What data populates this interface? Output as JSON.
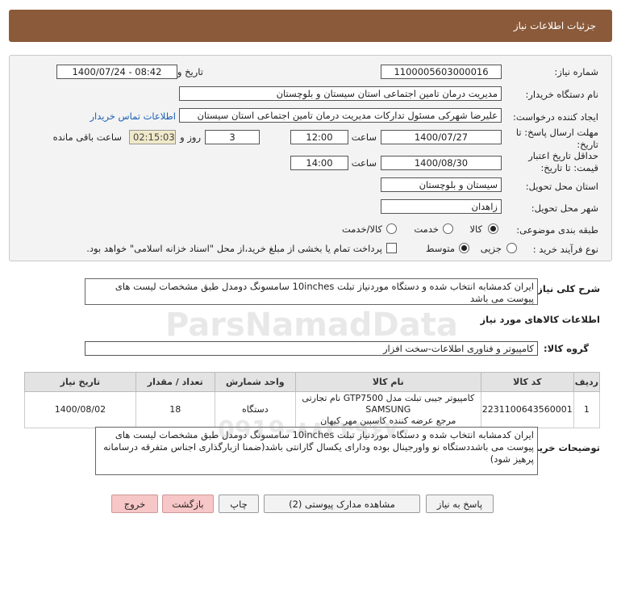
{
  "header": {
    "title": "جزئیات اطلاعات نیاز"
  },
  "form": {
    "need_number_label": "شماره نیاز:",
    "need_number": "1100005603000016",
    "announce_label": "تاریخ و ساعت اعلان عمومی:",
    "announce_value": "1400/07/24 - 08:42",
    "buyer_label": "نام دستگاه خریدار:",
    "buyer_value": "مدیریت درمان تامین اجتماعی استان سیستان و بلوچستان",
    "creator_label": "ایجاد کننده درخواست:",
    "creator_value": "علیرضا شهرکی مسئول تدارکات مدیریت درمان تامین اجتماعی استان سیستان",
    "contact_link": "اطلاعات تماس خریدار",
    "reply_deadline_label": "مهلت ارسال پاسخ: تا تاریخ:",
    "reply_date": "1400/07/27",
    "time_label": "ساعت",
    "reply_time": "12:00",
    "days_value": "3",
    "days_label": "روز و",
    "remaining_value": "02:15:03",
    "remaining_label": "ساعت باقی مانده",
    "validity_label": "حداقل تاریخ اعتبار قیمت: تا تاریخ:",
    "validity_date": "1400/08/30",
    "validity_time": "14:00",
    "province_label": "استان محل تحویل:",
    "province_value": "سیستان و بلوچستان",
    "city_label": "شهر محل تحویل:",
    "city_value": "زاهدان",
    "category_label": "طبقه بندی موضوعی:",
    "category_options": [
      "کالا",
      "خدمت",
      "کالا/خدمت"
    ],
    "category_selected": "کالا",
    "process_label": "نوع فرآیند خرید :",
    "process_options": [
      "جزیی",
      "متوسط"
    ],
    "process_selected": "متوسط",
    "payment_note": "پرداخت تمام یا بخشی از مبلغ خرید،از محل \"اسناد خزانه اسلامی\" خواهد بود."
  },
  "summary": {
    "label": "شرح کلی نیاز:",
    "text": "ایران کدمشابه انتخاب شده و دستگاه موردنیاز تبلت 10inches سامسونگ دومدل طبق مشخصات لیست های پیوست می باشد"
  },
  "goods": {
    "section_title": "اطلاعات کالاهای مورد نیاز",
    "group_label": "گروه کالا:",
    "group_value": "کامپیوتر و فناوری اطلاعات-سخت افزار",
    "columns": [
      "ردیف",
      "کد کالا",
      "نام کالا",
      "واحد شمارش",
      "تعداد / مقدار",
      "تاریخ نیاز"
    ],
    "rows": [
      {
        "index": "1",
        "code": "2231100643560001",
        "name_line1": "کامپیوتر جیبی تبلت مدل GTP7500 نام تجارتی SAMSUNG",
        "name_line2": "مرجع عرضه کننده کاسپین مهر کیهان",
        "unit": "دستگاه",
        "qty": "18",
        "date": "1400/08/02"
      }
    ]
  },
  "notes": {
    "label": "توضیحات خریدار:",
    "text": "ایران کدمشابه انتخاب شده و دستگاه موردنیاز تبلت 10inches سامسونگ دومدل طبق مشخصات لیست های پیوست می باشددستگاه نو واورجینال بوده ودارای یکسال گارانتی باشد(ضمنا ازبارگذاری اجناس متفرقه درسامانه پرهیز شود)"
  },
  "buttons": {
    "reply": "پاسخ به نیاز",
    "attachments": "مشاهده مدارک پیوستی (2)",
    "print": "چاپ",
    "back": "بازگشت",
    "exit": "خروج"
  },
  "watermark": {
    "brand": "ParsNamadData",
    "number": "0919-۸۸۳۴۹۶۷۰"
  }
}
